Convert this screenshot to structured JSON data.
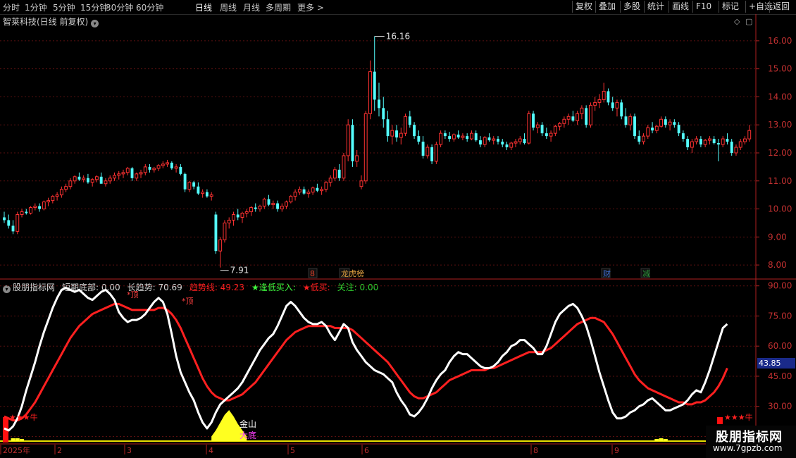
{
  "toolbar": {
    "periods": [
      "分时",
      "1分钟",
      "5分钟",
      "15分钟",
      "30分钟",
      "60分钟",
      "日线",
      "周线",
      "月线",
      "多周期",
      "更多 >"
    ],
    "active": "日线",
    "buttons": [
      "复权",
      "叠加",
      "多股",
      "统计",
      "画线",
      "F10",
      "标记",
      "+自选",
      "返回"
    ]
  },
  "main": {
    "title": "智莱科技(日线 前复权)",
    "high_label": "16.16",
    "low_label": "7.91",
    "price_ticks": [
      "16.00",
      "15.00",
      "14.00",
      "13.00",
      "12.00",
      "11.00",
      "10.00",
      "9.00",
      "8.00"
    ],
    "markers": [
      {
        "text": "8",
        "color": "#e0402a"
      },
      {
        "text": "龙虎榜",
        "color": "#e0a040"
      },
      {
        "text": "财",
        "color": "#3a6ad0"
      },
      {
        "text": "减",
        "color": "#2a9a3a"
      }
    ]
  },
  "indicator": {
    "name": "股朋指标网",
    "fields": [
      {
        "text": "短期底部: 0.00",
        "color": "#d8d8d8"
      },
      {
        "text": "长趋势: 70.69",
        "color": "#d8d8d8"
      },
      {
        "text": "趋势线: 49.23",
        "color": "#ff2020"
      },
      {
        "text": "★逢低买入:",
        "color": "#40ff40"
      },
      {
        "text": "★低买:",
        "color": "#ff2020"
      },
      {
        "text": "关注: 0.00",
        "color": "#30d030"
      }
    ],
    "ticks": [
      "90.00",
      "75.00",
      "60.00",
      "45.00",
      "30.00",
      "15.00"
    ],
    "current_value": "43.85",
    "labels": {
      "top1": "*顶",
      "top2": "*顶",
      "stars_left": "★★★牛",
      "stars_right": "★★★牛",
      "gold": "金山",
      "bottom": "大底"
    }
  },
  "timeline": {
    "labels": [
      "2025年",
      "2",
      "3",
      "4",
      "5",
      "6",
      "8",
      "9"
    ]
  },
  "watermark": {
    "name": "股朋指标网",
    "url": "www.7gpzb.com"
  },
  "chart_data": {
    "type": "candlestick",
    "price_axis": {
      "min": 7.6,
      "max": 16.5
    },
    "candles": [
      [
        9.7,
        9.9,
        9.5,
        9.6
      ],
      [
        9.6,
        9.8,
        9.3,
        9.4
      ],
      [
        9.4,
        9.6,
        9.1,
        9.2
      ],
      [
        9.2,
        9.9,
        9.1,
        9.8
      ],
      [
        9.8,
        10.0,
        9.7,
        9.9
      ],
      [
        9.9,
        10.0,
        9.8,
        9.85
      ],
      [
        9.85,
        10.1,
        9.8,
        10.05
      ],
      [
        10.05,
        10.2,
        9.95,
        10.1
      ],
      [
        10.1,
        10.2,
        9.9,
        10.0
      ],
      [
        10.0,
        10.3,
        9.95,
        10.25
      ],
      [
        10.25,
        10.4,
        10.1,
        10.3
      ],
      [
        10.3,
        10.5,
        10.2,
        10.45
      ],
      [
        10.45,
        10.6,
        10.3,
        10.5
      ],
      [
        10.5,
        10.8,
        10.4,
        10.7
      ],
      [
        10.7,
        10.9,
        10.6,
        10.8
      ],
      [
        10.8,
        11.1,
        10.7,
        11.0
      ],
      [
        11.0,
        11.2,
        10.9,
        11.15
      ],
      [
        11.15,
        11.3,
        11.0,
        11.05
      ],
      [
        11.05,
        11.2,
        10.95,
        11.1
      ],
      [
        11.1,
        11.25,
        10.9,
        10.95
      ],
      [
        10.95,
        11.1,
        10.8,
        11.05
      ],
      [
        11.05,
        11.2,
        10.95,
        11.15
      ],
      [
        11.15,
        11.3,
        11.0,
        10.9
      ],
      [
        10.9,
        11.1,
        10.8,
        11.0
      ],
      [
        11.0,
        11.2,
        10.9,
        11.1
      ],
      [
        11.1,
        11.3,
        11.0,
        11.2
      ],
      [
        11.2,
        11.35,
        11.05,
        11.25
      ],
      [
        11.25,
        11.4,
        11.1,
        11.3
      ],
      [
        11.3,
        11.5,
        11.2,
        11.45
      ],
      [
        11.45,
        11.5,
        11.0,
        11.1
      ],
      [
        11.1,
        11.3,
        11.0,
        11.25
      ],
      [
        11.25,
        11.4,
        11.1,
        11.3
      ],
      [
        11.3,
        11.6,
        11.2,
        11.5
      ],
      [
        11.5,
        11.6,
        11.3,
        11.4
      ],
      [
        11.4,
        11.5,
        11.3,
        11.45
      ],
      [
        11.45,
        11.6,
        11.35,
        11.55
      ],
      [
        11.55,
        11.7,
        11.45,
        11.6
      ],
      [
        11.6,
        11.75,
        11.5,
        11.65
      ],
      [
        11.65,
        11.7,
        11.4,
        11.45
      ],
      [
        11.45,
        11.6,
        11.3,
        11.5
      ],
      [
        11.5,
        11.6,
        11.2,
        11.25
      ],
      [
        11.25,
        11.3,
        10.6,
        10.7
      ],
      [
        10.7,
        11.0,
        10.6,
        10.95
      ],
      [
        10.95,
        11.0,
        10.7,
        10.8
      ],
      [
        10.8,
        10.95,
        10.5,
        10.55
      ],
      [
        10.55,
        10.7,
        10.4,
        10.6
      ],
      [
        10.6,
        10.7,
        10.4,
        10.45
      ],
      [
        10.45,
        10.6,
        10.3,
        10.5
      ],
      [
        9.8,
        9.9,
        8.4,
        8.5
      ],
      [
        8.5,
        9.0,
        7.91,
        8.9
      ],
      [
        8.9,
        9.6,
        8.8,
        9.5
      ],
      [
        9.5,
        9.7,
        9.3,
        9.6
      ],
      [
        9.6,
        9.9,
        9.4,
        9.8
      ],
      [
        9.8,
        10.0,
        9.6,
        9.7
      ],
      [
        9.7,
        9.9,
        9.5,
        9.85
      ],
      [
        9.85,
        10.0,
        9.7,
        9.9
      ],
      [
        9.9,
        10.1,
        9.75,
        10.05
      ],
      [
        10.05,
        10.2,
        9.9,
        10.0
      ],
      [
        10.0,
        10.15,
        9.9,
        10.1
      ],
      [
        10.1,
        10.4,
        10.0,
        10.35
      ],
      [
        10.35,
        10.5,
        10.1,
        10.15
      ],
      [
        10.15,
        10.3,
        10.0,
        10.2
      ],
      [
        10.2,
        10.3,
        9.9,
        10.0
      ],
      [
        10.0,
        10.2,
        9.9,
        10.1
      ],
      [
        10.1,
        10.3,
        10.0,
        10.25
      ],
      [
        10.25,
        10.5,
        10.2,
        10.45
      ],
      [
        10.45,
        10.7,
        10.3,
        10.6
      ],
      [
        10.6,
        10.8,
        10.5,
        10.7
      ],
      [
        10.7,
        10.8,
        10.5,
        10.55
      ],
      [
        10.55,
        10.7,
        10.4,
        10.6
      ],
      [
        10.6,
        10.8,
        10.5,
        10.75
      ],
      [
        10.75,
        10.9,
        10.6,
        10.65
      ],
      [
        10.65,
        10.8,
        10.5,
        10.7
      ],
      [
        10.7,
        11.0,
        10.6,
        10.95
      ],
      [
        10.95,
        11.2,
        10.8,
        11.1
      ],
      [
        11.1,
        11.5,
        11.0,
        11.4
      ],
      [
        11.4,
        11.6,
        11.0,
        11.1
      ],
      [
        11.1,
        12.0,
        11.0,
        11.9
      ],
      [
        11.9,
        13.2,
        11.7,
        13.0
      ],
      [
        13.0,
        13.2,
        11.5,
        11.7
      ],
      [
        11.7,
        12.1,
        11.5,
        11.9
      ],
      [
        10.8,
        11.2,
        10.7,
        11.0
      ],
      [
        11.0,
        13.5,
        10.9,
        13.4
      ],
      [
        13.4,
        15.3,
        13.2,
        14.9
      ],
      [
        14.9,
        16.16,
        13.5,
        13.9
      ],
      [
        13.9,
        14.5,
        13.3,
        13.6
      ],
      [
        13.6,
        14.0,
        12.9,
        13.2
      ],
      [
        13.2,
        13.5,
        12.4,
        12.6
      ],
      [
        12.6,
        13.0,
        12.3,
        12.8
      ],
      [
        12.8,
        13.0,
        12.4,
        12.55
      ],
      [
        12.55,
        12.9,
        12.3,
        12.7
      ],
      [
        12.7,
        13.4,
        12.6,
        13.3
      ],
      [
        13.3,
        13.5,
        12.9,
        13.0
      ],
      [
        13.0,
        13.1,
        12.5,
        12.6
      ],
      [
        12.6,
        12.8,
        12.3,
        12.4
      ],
      [
        12.4,
        12.6,
        11.8,
        11.9
      ],
      [
        11.9,
        12.3,
        11.8,
        12.2
      ],
      [
        12.2,
        12.3,
        11.6,
        11.7
      ],
      [
        11.7,
        12.4,
        11.6,
        12.3
      ],
      [
        12.3,
        12.8,
        12.2,
        12.7
      ],
      [
        12.7,
        12.8,
        12.5,
        12.6
      ],
      [
        12.6,
        12.75,
        12.4,
        12.5
      ],
      [
        12.5,
        12.7,
        12.4,
        12.65
      ],
      [
        12.65,
        12.8,
        12.5,
        12.55
      ],
      [
        12.55,
        12.7,
        12.45,
        12.6
      ],
      [
        12.6,
        12.7,
        12.4,
        12.5
      ],
      [
        12.5,
        12.8,
        12.45,
        12.7
      ],
      [
        12.7,
        12.8,
        12.4,
        12.45
      ],
      [
        12.45,
        12.6,
        12.2,
        12.3
      ],
      [
        12.3,
        12.6,
        12.2,
        12.55
      ],
      [
        12.55,
        12.7,
        12.4,
        12.45
      ],
      [
        12.45,
        12.6,
        12.3,
        12.5
      ],
      [
        12.5,
        12.6,
        12.3,
        12.4
      ],
      [
        12.4,
        12.5,
        12.2,
        12.3
      ],
      [
        12.3,
        12.4,
        12.1,
        12.2
      ],
      [
        12.2,
        12.4,
        12.1,
        12.35
      ],
      [
        12.35,
        12.5,
        12.2,
        12.4
      ],
      [
        12.4,
        12.6,
        12.3,
        12.5
      ],
      [
        12.5,
        12.7,
        12.3,
        12.35
      ],
      [
        12.35,
        13.5,
        12.3,
        13.4
      ],
      [
        13.4,
        13.5,
        12.8,
        12.9
      ],
      [
        12.9,
        13.1,
        12.7,
        13.0
      ],
      [
        13.0,
        13.1,
        12.6,
        12.7
      ],
      [
        12.7,
        12.9,
        12.5,
        12.6
      ],
      [
        12.6,
        12.8,
        12.4,
        12.7
      ],
      [
        12.7,
        13.0,
        12.6,
        12.95
      ],
      [
        12.95,
        13.1,
        12.8,
        13.05
      ],
      [
        13.05,
        13.3,
        12.9,
        13.2
      ],
      [
        13.2,
        13.4,
        13.0,
        13.3
      ],
      [
        13.3,
        13.5,
        13.1,
        13.15
      ],
      [
        13.15,
        13.5,
        13.0,
        13.4
      ],
      [
        13.4,
        13.7,
        13.2,
        13.6
      ],
      [
        13.6,
        13.7,
        12.9,
        13.0
      ],
      [
        13.0,
        13.8,
        12.9,
        13.7
      ],
      [
        13.7,
        14.0,
        13.5,
        13.8
      ],
      [
        13.8,
        14.1,
        13.6,
        13.9
      ],
      [
        13.9,
        14.5,
        13.8,
        14.2
      ],
      [
        14.2,
        14.3,
        13.7,
        13.8
      ],
      [
        13.8,
        14.0,
        13.5,
        13.6
      ],
      [
        13.6,
        13.9,
        13.3,
        13.8
      ],
      [
        13.8,
        13.9,
        13.2,
        13.3
      ],
      [
        13.3,
        13.6,
        12.9,
        13.0
      ],
      [
        13.0,
        13.4,
        12.8,
        13.3
      ],
      [
        13.3,
        13.4,
        12.5,
        12.6
      ],
      [
        12.6,
        12.8,
        12.3,
        12.4
      ],
      [
        12.4,
        12.7,
        12.3,
        12.6
      ],
      [
        12.6,
        13.0,
        12.5,
        12.9
      ],
      [
        12.9,
        13.1,
        12.7,
        12.8
      ],
      [
        12.8,
        13.0,
        12.7,
        12.95
      ],
      [
        12.95,
        13.3,
        12.9,
        13.2
      ],
      [
        13.2,
        13.3,
        12.9,
        13.0
      ],
      [
        13.0,
        13.2,
        12.8,
        13.1
      ],
      [
        13.1,
        13.2,
        12.9,
        13.0
      ],
      [
        13.0,
        13.1,
        12.6,
        12.7
      ],
      [
        12.7,
        12.8,
        12.4,
        12.5
      ],
      [
        12.5,
        12.6,
        12.1,
        12.2
      ],
      [
        12.2,
        12.5,
        12.0,
        12.4
      ],
      [
        12.4,
        12.6,
        12.3,
        12.5
      ],
      [
        12.5,
        12.6,
        12.2,
        12.3
      ],
      [
        12.3,
        12.5,
        12.2,
        12.45
      ],
      [
        12.45,
        12.6,
        12.3,
        12.5
      ],
      [
        12.5,
        12.6,
        12.3,
        12.35
      ],
      [
        12.35,
        12.5,
        11.7,
        12.3
      ],
      [
        12.3,
        12.6,
        12.2,
        12.5
      ],
      [
        12.5,
        12.7,
        12.3,
        12.4
      ],
      [
        12.4,
        12.5,
        11.9,
        12.0
      ],
      [
        12.0,
        12.3,
        11.9,
        12.2
      ],
      [
        12.2,
        12.5,
        12.1,
        12.4
      ],
      [
        12.4,
        12.6,
        12.3,
        12.5
      ],
      [
        12.5,
        13.0,
        12.4,
        12.8
      ]
    ],
    "indicator_axis": {
      "min": 12,
      "max": 92
    },
    "white_line": [
      19,
      18,
      20,
      24,
      30,
      38,
      45,
      52,
      60,
      67,
      73,
      79,
      84,
      88,
      89,
      88,
      87,
      88,
      86,
      84,
      83,
      85,
      87,
      88,
      86,
      83,
      77,
      74,
      72,
      73,
      73,
      74,
      76,
      79,
      82,
      84,
      82,
      76,
      66,
      55,
      47,
      42,
      37,
      33,
      27,
      22,
      19,
      22,
      27,
      31,
      33,
      35,
      37,
      39,
      42,
      46,
      50,
      54,
      58,
      61,
      64,
      66,
      70,
      75,
      80,
      82,
      80,
      77,
      74,
      72,
      71,
      71,
      72,
      70,
      66,
      63,
      67,
      71,
      69,
      62,
      58,
      55,
      52,
      50,
      48,
      47,
      46,
      44,
      42,
      37,
      33,
      30,
      26,
      25,
      27,
      30,
      34,
      39,
      43,
      46,
      48,
      52,
      55,
      57,
      56,
      56,
      54,
      52,
      50,
      49,
      49,
      50,
      52,
      55,
      57,
      60,
      61,
      63,
      63,
      61,
      59,
      56,
      56,
      60,
      66,
      72,
      76,
      78,
      80,
      81,
      79,
      75,
      70,
      63,
      55,
      47,
      40,
      33,
      27,
      24,
      24,
      25,
      27,
      28,
      30,
      31,
      33,
      34,
      32,
      30,
      28,
      28,
      29,
      30,
      31,
      33,
      36,
      38,
      37,
      42,
      48,
      55,
      62,
      69,
      71
    ],
    "red_line": [
      25,
      24,
      23,
      23,
      24,
      26,
      29,
      32,
      36,
      40,
      44,
      48,
      52,
      56,
      60,
      64,
      67,
      70,
      72,
      74,
      76,
      77,
      78,
      79,
      80,
      81,
      81,
      80,
      79,
      78,
      78,
      78,
      78,
      78,
      78,
      79,
      79,
      78,
      76,
      73,
      69,
      64,
      59,
      54,
      49,
      44,
      40,
      37,
      35,
      34,
      33,
      33,
      34,
      35,
      36,
      38,
      40,
      42,
      45,
      48,
      51,
      54,
      57,
      60,
      63,
      65,
      67,
      68,
      69,
      70,
      70,
      70,
      70,
      70,
      70,
      69,
      69,
      69,
      69,
      68,
      66,
      64,
      62,
      60,
      58,
      56,
      54,
      52,
      49,
      46,
      43,
      40,
      37,
      35,
      34,
      34,
      35,
      36,
      37,
      39,
      41,
      43,
      44,
      45,
      46,
      47,
      48,
      48,
      48,
      48,
      49,
      49,
      50,
      51,
      52,
      53,
      54,
      55,
      56,
      57,
      57,
      57,
      57,
      58,
      59,
      61,
      63,
      65,
      67,
      69,
      71,
      72,
      73,
      74,
      74,
      73,
      72,
      69,
      66,
      62,
      58,
      54,
      50,
      46,
      43,
      41,
      39,
      38,
      37,
      36,
      35,
      34,
      33,
      32,
      32,
      31,
      31,
      32,
      32,
      33,
      35,
      37,
      40,
      44,
      49
    ],
    "yellow_area": [
      {
        "i": 47,
        "v": 0.15
      },
      {
        "i": 48,
        "v": 0.35
      },
      {
        "i": 49,
        "v": 0.6
      },
      {
        "i": 50,
        "v": 0.85
      },
      {
        "i": 51,
        "v": 1.0
      },
      {
        "i": 52,
        "v": 0.8
      },
      {
        "i": 53,
        "v": 0.55
      },
      {
        "i": 54,
        "v": 0.35
      },
      {
        "i": 55,
        "v": 0.15
      }
    ]
  }
}
